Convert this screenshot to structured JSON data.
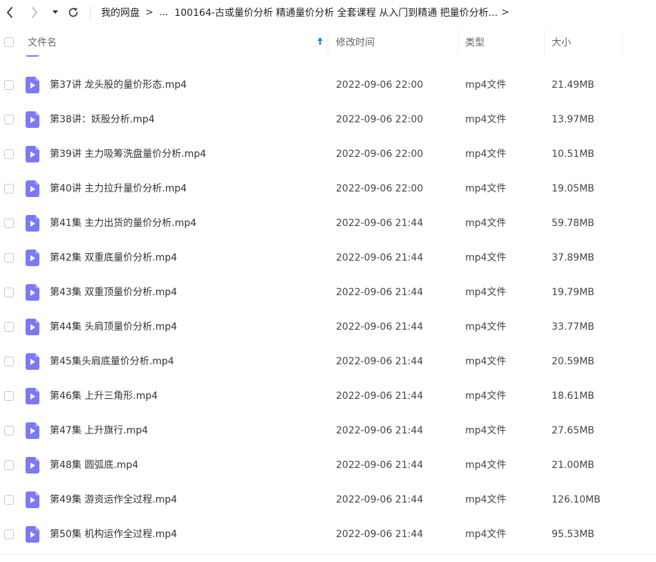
{
  "nav": {
    "back_icon": "chevron-left-icon",
    "forward_icon": "chevron-right-icon",
    "dropdown_icon": "caret-down-icon",
    "refresh_icon": "refresh-icon"
  },
  "breadcrumb": {
    "root": "我的网盘",
    "separator": ">",
    "ellipsis": "...",
    "current": "100164-古或量价分析 精通量价分析 全套课程 从入门到精通 把量价分析...",
    "trailing_separator": ">"
  },
  "header": {
    "name": "文件名",
    "modified": "修改时间",
    "type": "类型",
    "size": "大小",
    "sort_icon": "sort-ascending-arrow-icon"
  },
  "colors": {
    "file_icon": "#7b79f5",
    "sort_arrow": "#1e88e5"
  },
  "files": [
    {
      "name": "第37讲 龙头股的量价形态.mp4",
      "modified": "2022-09-06 22:00",
      "type": "mp4文件",
      "size": "21.49MB"
    },
    {
      "name": "第38讲：妖股分析.mp4",
      "modified": "2022-09-06 22:00",
      "type": "mp4文件",
      "size": "13.97MB"
    },
    {
      "name": "第39讲 主力吸筹洗盘量价分析.mp4",
      "modified": "2022-09-06 22:00",
      "type": "mp4文件",
      "size": "10.51MB"
    },
    {
      "name": "第40讲 主力拉升量价分析.mp4",
      "modified": "2022-09-06 22:00",
      "type": "mp4文件",
      "size": "19.05MB"
    },
    {
      "name": "第41集 主力出货的量价分析.mp4",
      "modified": "2022-09-06 21:44",
      "type": "mp4文件",
      "size": "59.78MB"
    },
    {
      "name": "第42集 双重底量价分析.mp4",
      "modified": "2022-09-06 21:44",
      "type": "mp4文件",
      "size": "37.89MB"
    },
    {
      "name": "第43集 双重顶量价分析.mp4",
      "modified": "2022-09-06 21:44",
      "type": "mp4文件",
      "size": "19.79MB"
    },
    {
      "name": "第44集 头肩顶量价分析.mp4",
      "modified": "2022-09-06 21:44",
      "type": "mp4文件",
      "size": "33.77MB"
    },
    {
      "name": "第45集头肩底量价分析.mp4",
      "modified": "2022-09-06 21:44",
      "type": "mp4文件",
      "size": "20.59MB"
    },
    {
      "name": "第46集 上升三角形.mp4",
      "modified": "2022-09-06 21:44",
      "type": "mp4文件",
      "size": "18.61MB"
    },
    {
      "name": "第47集 上升旗行.mp4",
      "modified": "2022-09-06 21:44",
      "type": "mp4文件",
      "size": "27.65MB"
    },
    {
      "name": "第48集 圆弧底.mp4",
      "modified": "2022-09-06 21:44",
      "type": "mp4文件",
      "size": "21.00MB"
    },
    {
      "name": "第49集 游资运作全过程.mp4",
      "modified": "2022-09-06 21:44",
      "type": "mp4文件",
      "size": "126.10MB"
    },
    {
      "name": "第50集 机构运作全过程.mp4",
      "modified": "2022-09-06 21:44",
      "type": "mp4文件",
      "size": "95.53MB"
    }
  ]
}
